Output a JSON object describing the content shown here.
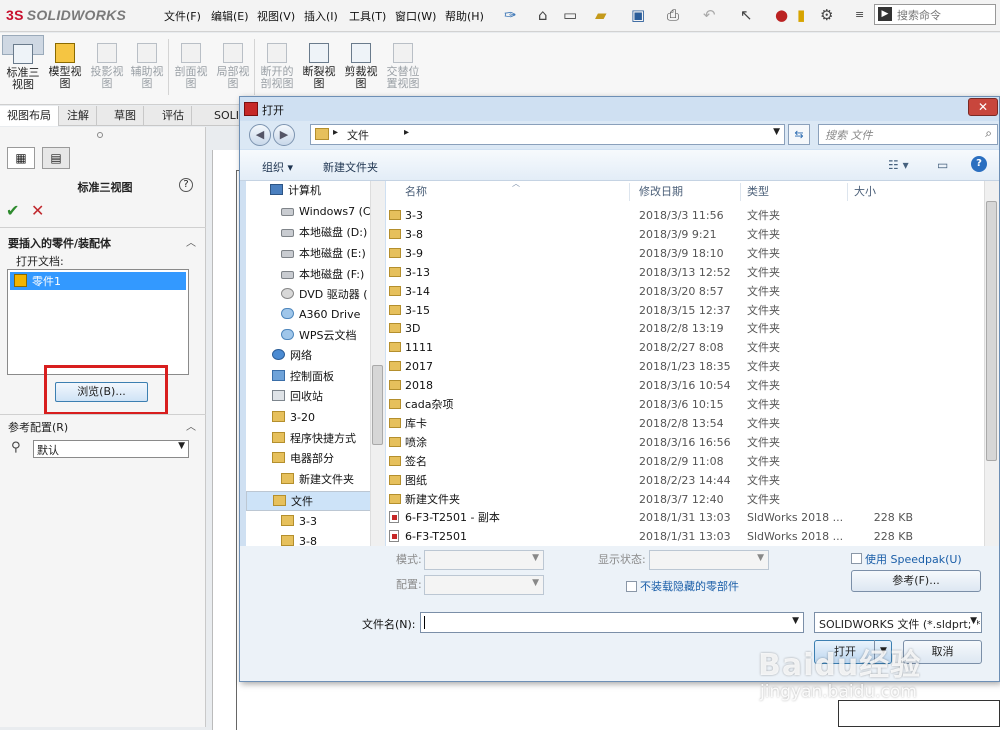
{
  "app": {
    "logo_ds": "3S",
    "logo_text": "SOLIDWORKS",
    "menu": [
      "文件(F)",
      "编辑(E)",
      "视图(V)",
      "插入(I)",
      "工具(T)",
      "窗口(W)",
      "帮助(H)"
    ],
    "pin_icon": "pin-icon",
    "search_placeholder": "搜索命令"
  },
  "ribbon": {
    "buttons": [
      {
        "label": "标准三视图",
        "state": "selected"
      },
      {
        "label": "模型视图",
        "state": "enabled"
      },
      {
        "label": "投影视图",
        "state": "disabled"
      },
      {
        "label": "辅助视图",
        "state": "disabled"
      },
      {
        "label": "剖面视图",
        "state": "disabled"
      },
      {
        "label": "局部视图",
        "state": "disabled"
      },
      {
        "label": "断开的剖视图",
        "state": "disabled"
      },
      {
        "label": "断裂视图",
        "state": "enabled"
      },
      {
        "label": "剪裁视图",
        "state": "enabled"
      },
      {
        "label": "交替位置视图",
        "state": "disabled"
      }
    ],
    "tabs": [
      "视图布局",
      "注解",
      "草图",
      "评估",
      "SOLI"
    ]
  },
  "panel": {
    "title": "标准三视图",
    "help": "?",
    "ok": "✔",
    "cancel": "✕",
    "section1": "要插入的零件/装配体",
    "open_docs_label": "打开文档:",
    "open_doc_item": "零件1",
    "browse": "浏览(B)...",
    "section2": "参考配置(R)",
    "config_value": "默认"
  },
  "dialog": {
    "title": "打开",
    "close": "✕",
    "address": "文件",
    "search_placeholder": "搜索 文件",
    "organize": "组织 ▾",
    "new_folder": "新建文件夹",
    "help": "?",
    "tree": [
      {
        "label": "计算机",
        "icon": "pc"
      },
      {
        "label": "Windows7 (C:",
        "icon": "drv"
      },
      {
        "label": "本地磁盘 (D:)",
        "icon": "drv"
      },
      {
        "label": "本地磁盘 (E:)",
        "icon": "drv"
      },
      {
        "label": "本地磁盘 (F:)",
        "icon": "drv"
      },
      {
        "label": "DVD 驱动器 (",
        "icon": "dvd"
      },
      {
        "label": "A360 Drive",
        "icon": "cld"
      },
      {
        "label": "WPS云文档",
        "icon": "cld"
      },
      {
        "label": "网络",
        "icon": "net"
      },
      {
        "label": "控制面板",
        "icon": "cp"
      },
      {
        "label": "回收站",
        "icon": "bin"
      },
      {
        "label": "3-20",
        "icon": "fold"
      },
      {
        "label": "程序快捷方式",
        "icon": "fold"
      },
      {
        "label": "电器部分",
        "icon": "fold"
      },
      {
        "label": "新建文件夹",
        "icon": "fold"
      },
      {
        "label": "文件",
        "icon": "fold"
      },
      {
        "label": "3-3",
        "icon": "fold"
      },
      {
        "label": "3-8",
        "icon": "fold"
      }
    ],
    "columns": {
      "name": "名称",
      "date": "修改日期",
      "type": "类型",
      "size": "大小"
    },
    "files": [
      {
        "name": "3-3",
        "date": "2018/3/3 11:56",
        "type": "文件夹",
        "size": "",
        "kind": "folder"
      },
      {
        "name": "3-8",
        "date": "2018/3/9 9:21",
        "type": "文件夹",
        "size": "",
        "kind": "folder"
      },
      {
        "name": "3-9",
        "date": "2018/3/9 18:10",
        "type": "文件夹",
        "size": "",
        "kind": "folder"
      },
      {
        "name": "3-13",
        "date": "2018/3/13 12:52",
        "type": "文件夹",
        "size": "",
        "kind": "folder"
      },
      {
        "name": "3-14",
        "date": "2018/3/20 8:57",
        "type": "文件夹",
        "size": "",
        "kind": "folder"
      },
      {
        "name": "3-15",
        "date": "2018/3/15 12:37",
        "type": "文件夹",
        "size": "",
        "kind": "folder"
      },
      {
        "name": "3D",
        "date": "2018/2/8 13:19",
        "type": "文件夹",
        "size": "",
        "kind": "folder"
      },
      {
        "name": "1111",
        "date": "2018/2/27 8:08",
        "type": "文件夹",
        "size": "",
        "kind": "folder"
      },
      {
        "name": "2017",
        "date": "2018/1/23 18:35",
        "type": "文件夹",
        "size": "",
        "kind": "folder"
      },
      {
        "name": "2018",
        "date": "2018/3/16 10:54",
        "type": "文件夹",
        "size": "",
        "kind": "folder"
      },
      {
        "name": "cada杂项",
        "date": "2018/3/6 10:15",
        "type": "文件夹",
        "size": "",
        "kind": "folder"
      },
      {
        "name": "库卡",
        "date": "2018/2/8 13:54",
        "type": "文件夹",
        "size": "",
        "kind": "folder"
      },
      {
        "name": "喷涂",
        "date": "2018/3/16 16:56",
        "type": "文件夹",
        "size": "",
        "kind": "folder"
      },
      {
        "name": "签名",
        "date": "2018/2/9 11:08",
        "type": "文件夹",
        "size": "",
        "kind": "folder"
      },
      {
        "name": "图纸",
        "date": "2018/2/23 14:44",
        "type": "文件夹",
        "size": "",
        "kind": "folder"
      },
      {
        "name": "新建文件夹",
        "date": "2018/3/7 12:40",
        "type": "文件夹",
        "size": "",
        "kind": "folder"
      },
      {
        "name": "6-F3-T2501 - 副本",
        "date": "2018/1/31 13:03",
        "type": "SldWorks 2018 ...",
        "size": "228 KB",
        "kind": "doc"
      },
      {
        "name": "6-F3-T2501",
        "date": "2018/1/31 13:03",
        "type": "SldWorks 2018 ...",
        "size": "228 KB",
        "kind": "doc"
      }
    ],
    "mode_label": "模式:",
    "display_state_label": "显示状态:",
    "config_label": "配置:",
    "use_speedpak": "使用 Speedpak(U)",
    "no_load_hidden": "不装载隐藏的零部件",
    "references": "参考(F)...",
    "filename_label": "文件名(N):",
    "filename_value": "",
    "filetype": "SOLIDWORKS 文件 (*.sldprt; *.sldasm; *.slddrw)",
    "open": "打开",
    "cancel": "取消"
  },
  "watermark": {
    "line1": "Baidu经验",
    "line2": "jingyan.baidu.com"
  }
}
